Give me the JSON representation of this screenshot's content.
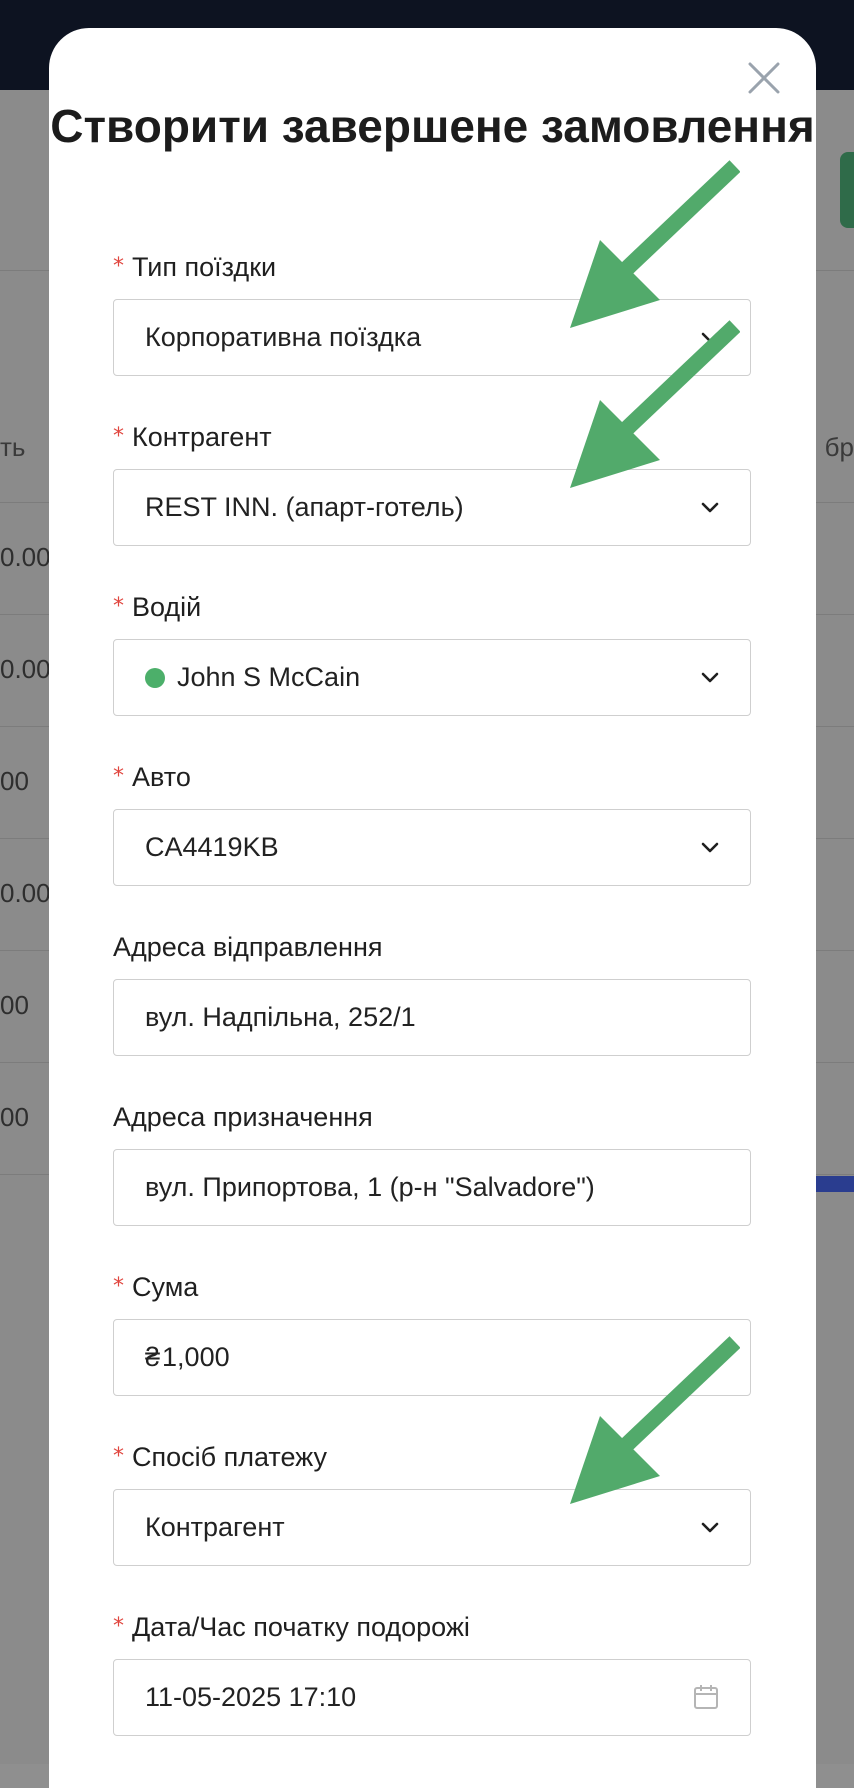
{
  "background": {
    "left_fragments": [
      "ть",
      "0.00",
      "0.00",
      "00",
      "0.00",
      "00",
      "00"
    ],
    "right_fragment": "бр"
  },
  "modal": {
    "title": "Створити завершене замовлення",
    "close_icon": "close-icon",
    "required_marker": "*",
    "fields": {
      "trip_type": {
        "label": "Тип поїздки",
        "value": "Корпоративна поїздка",
        "required": true
      },
      "counterparty": {
        "label": "Контрагент",
        "value": "REST INN. (апарт-готель)",
        "required": true
      },
      "driver": {
        "label": "Водій",
        "value": "John S McCain",
        "required": true,
        "status_color": "#4caf6a"
      },
      "car": {
        "label": "Авто",
        "value": "CA4419KB",
        "required": true
      },
      "departure": {
        "label": "Адреса відправлення",
        "value": "вул. Надпільна, 252/1",
        "required": false
      },
      "destination": {
        "label": "Адреса призначення",
        "value": "вул. Припортова, 1 (р-н \"Salvadore\")",
        "required": false
      },
      "amount": {
        "label": "Сума",
        "currency": "₴",
        "value": "1,000",
        "required": true
      },
      "payment_method": {
        "label": "Спосіб платежу",
        "value": "Контрагент",
        "required": true
      },
      "start_datetime": {
        "label": "Дата/Час початку подорожі",
        "value": "11-05-2025 17:10",
        "required": true
      }
    }
  },
  "colors": {
    "arrow": "#52aa6b",
    "required": "#e0463f",
    "topbar": "#0d1321"
  },
  "icons": {
    "chevron": "chevron-down-icon",
    "calendar": "calendar-icon",
    "arrow": "arrow-annotation-icon"
  }
}
